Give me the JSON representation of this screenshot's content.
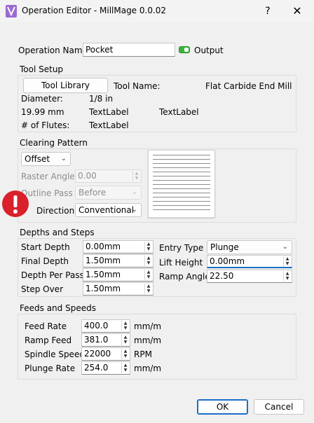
{
  "window": {
    "title": "Operation Editor - MillMage 0.0.02",
    "help_glyph": "?",
    "close_glyph": "✕"
  },
  "operation": {
    "name_label": "Operation Name",
    "name_value": "Pocket",
    "output_label": "Output",
    "output_enabled": true
  },
  "tool_setup": {
    "title": "Tool Setup",
    "library_button": "Tool Library",
    "tool_name_label": "Tool Name:",
    "tool_name_value": "Flat Carbide End Mill",
    "diameter_label": "Diameter:",
    "diameter_value": "1/8 in",
    "diameter_mm": "19.99 mm",
    "text_label_1": "TextLabel",
    "text_label_2": "TextLabel",
    "flutes_label": "# of Flutes:",
    "flutes_value": "TextLabel"
  },
  "clearing": {
    "title": "Clearing Pattern",
    "pattern_value": "Offset",
    "raster_angle_label": "Raster Angle",
    "raster_angle_value": "0.00",
    "outline_pass_label": "Outline Pass",
    "outline_pass_value": "Before",
    "direction_label": "Direction",
    "direction_value": "Conventional"
  },
  "depths": {
    "title": "Depths and Steps",
    "start_depth_label": "Start Depth",
    "start_depth_value": "0.00mm",
    "final_depth_label": "Final Depth",
    "final_depth_value": "1.50mm",
    "depth_per_pass_label": "Depth Per Pass",
    "depth_per_pass_value": "1.50mm",
    "step_over_label": "Step Over",
    "step_over_value": "1.50mm",
    "entry_type_label": "Entry Type",
    "entry_type_value": "Plunge",
    "lift_height_label": "Lift Height",
    "lift_height_value": "0.00mm",
    "ramp_angle_label": "Ramp Angle",
    "ramp_angle_value": "22.50"
  },
  "feeds": {
    "title": "Feeds and Speeds",
    "feed_rate_label": "Feed Rate",
    "feed_rate_value": "400.0",
    "feed_rate_unit": "mm/m",
    "ramp_feed_label": "Ramp Feed",
    "ramp_feed_value": "381.0",
    "ramp_feed_unit": "mm/m",
    "spindle_speed_label": "Spindle Speed",
    "spindle_speed_value": "22000",
    "spindle_speed_unit": "RPM",
    "plunge_rate_label": "Plunge Rate",
    "plunge_rate_value": "254.0",
    "plunge_rate_unit": "mm/m"
  },
  "buttons": {
    "ok": "OK",
    "cancel": "Cancel"
  },
  "colors": {
    "accent": "#1b6ec8",
    "warning": "#d9202b",
    "toggle_on": "#3cb43c"
  }
}
